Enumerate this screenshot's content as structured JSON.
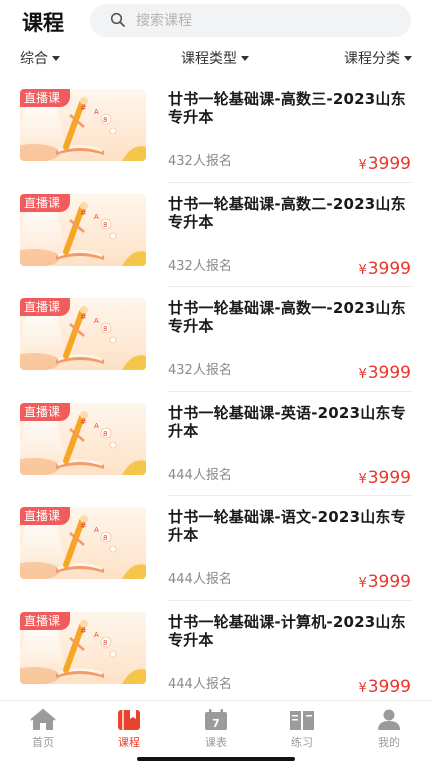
{
  "header": {
    "title": "课程",
    "search_placeholder": "搜索课程"
  },
  "filters": {
    "sort": "综合",
    "type": "课程类型",
    "category": "课程分类"
  },
  "courses": [
    {
      "badge": "直播课",
      "title": "廿书一轮基础课-高数三-2023山东专升本",
      "enroll": "432人报名",
      "currency": "¥",
      "price": "3999"
    },
    {
      "badge": "直播课",
      "title": "廿书一轮基础课-高数二-2023山东专升本",
      "enroll": "432人报名",
      "currency": "¥",
      "price": "3999"
    },
    {
      "badge": "直播课",
      "title": "廿书一轮基础课-高数一-2023山东专升本",
      "enroll": "432人报名",
      "currency": "¥",
      "price": "3999"
    },
    {
      "badge": "直播课",
      "title": "廿书一轮基础课-英语-2023山东专升本",
      "enroll": "444人报名",
      "currency": "¥",
      "price": "3999"
    },
    {
      "badge": "直播课",
      "title": "廿书一轮基础课-语文-2023山东专升本",
      "enroll": "444人报名",
      "currency": "¥",
      "price": "3999"
    },
    {
      "badge": "直播课",
      "title": "廿书一轮基础课-计算机-2023山东专升本",
      "enroll": "444人报名",
      "currency": "¥",
      "price": "3999"
    }
  ],
  "tabbar": {
    "items": [
      {
        "label": "首页",
        "icon": "home-icon",
        "active": false
      },
      {
        "label": "课程",
        "icon": "course-icon",
        "active": true
      },
      {
        "label": "课表",
        "icon": "calendar-icon",
        "active": false,
        "icon_text": "7"
      },
      {
        "label": "练习",
        "icon": "practice-book-icon",
        "active": false
      },
      {
        "label": "我的",
        "icon": "profile-icon",
        "active": false
      }
    ]
  },
  "colors": {
    "accent": "#e8432c",
    "price": "#e8362b",
    "badge": "#f25b5b",
    "inactive": "#9b9b9b"
  }
}
